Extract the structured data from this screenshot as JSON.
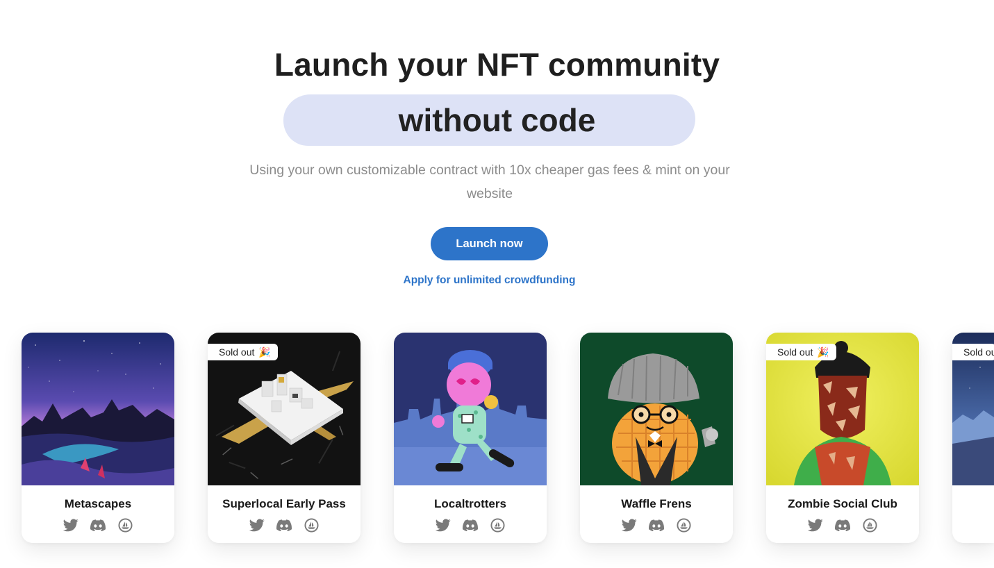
{
  "hero": {
    "title_line1": "Launch your NFT community",
    "title_line2": "without code",
    "subtitle": "Using your own customizable contract with 10x cheaper gas fees & mint on your website",
    "launch_button": "Launch now",
    "apply_link": "Apply for unlimited crowdfunding"
  },
  "colors": {
    "accent": "#2d74c9",
    "highlight": "#dde2f6",
    "subtitle": "#8c8c8c",
    "icon": "#7a7a7a"
  },
  "cards": [
    {
      "name": "Metascapes",
      "sold_out": false,
      "image": "starry-mountain-landscape"
    },
    {
      "name": "Superlocal Early Pass",
      "sold_out": true,
      "sold_label": "Sold out",
      "image": "phone-airplane-art"
    },
    {
      "name": "Localtrotters",
      "sold_out": false,
      "image": "pink-character-skating"
    },
    {
      "name": "Waffle Frens",
      "sold_out": false,
      "image": "waffle-character"
    },
    {
      "name": "Zombie Social Club",
      "sold_out": true,
      "sold_label": "Sold out",
      "image": "zombie-portrait"
    },
    {
      "name": "",
      "sold_out": true,
      "sold_label": "Sold ou",
      "image": "night-sky-mountains"
    }
  ],
  "social_icons": [
    "twitter-icon",
    "discord-icon",
    "opensea-icon"
  ]
}
